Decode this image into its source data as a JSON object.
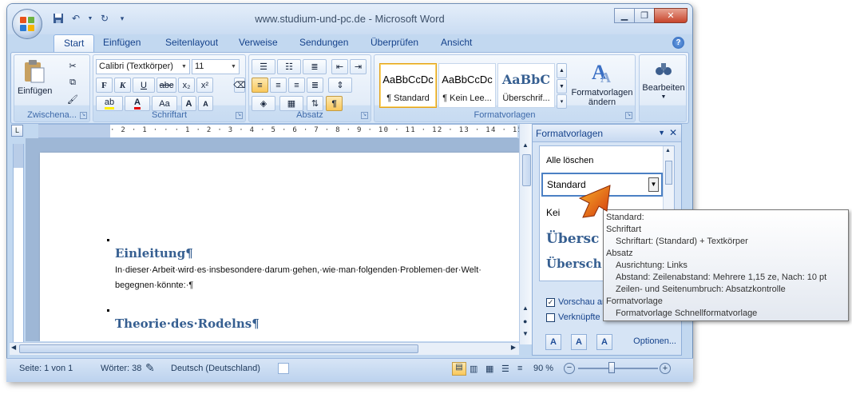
{
  "window": {
    "title": "www.studium-und-pc.de - Microsoft Word"
  },
  "quick_access": {
    "icons": [
      "save-icon",
      "undo-icon",
      "redo-icon",
      "customize-icon"
    ]
  },
  "tabs": [
    "Start",
    "Einfügen",
    "Seitenlayout",
    "Verweise",
    "Sendungen",
    "Überprüfen",
    "Ansicht"
  ],
  "ribbon": {
    "clipboard": {
      "paste_label": "Einfügen",
      "group_label": "Zwischena..."
    },
    "font": {
      "font_name": "Calibri (Textkörper)",
      "font_size": "11",
      "bold": "F",
      "italic": "K",
      "underline": "U",
      "strike": "abc",
      "sub": "x₂",
      "sup": "x²",
      "grow": "A",
      "shrink": "A",
      "case": "Aa",
      "group_label": "Schriftart"
    },
    "paragraph": {
      "group_label": "Absatz",
      "show_marks": "¶"
    },
    "styles": {
      "items": [
        {
          "sample": "AaBbCcDc",
          "name": "¶ Standard"
        },
        {
          "sample": "AaBbCcDc",
          "name": "¶ Kein Lee..."
        },
        {
          "sample": "AaBbC",
          "name": "Überschrif..."
        }
      ],
      "change_label_1": "Formatvorlagen",
      "change_label_2": "ändern",
      "group_label": "Formatvorlagen"
    },
    "editing": {
      "label": "Bearbeiten"
    }
  },
  "ruler": {
    "numbers": "· 2 · 1 · · · 1 · 2 · 3 · 4 · 5 · 6 · 7 · 8 · 9 · 10 · 11 · 12 · 13 · 14 · 15"
  },
  "document": {
    "heading1": "Einleitung¶",
    "para1_line1": "In·dieser·Arbeit·wird·es·insbesondere·darum·gehen,·wie·man·folgenden·Problemen·der·Welt·",
    "para1_line2": "begegnen·könnte:·¶",
    "heading2": "Theorie·des·Rodelns¶"
  },
  "task_pane": {
    "title": "Formatvorlagen",
    "clear_all": "Alle löschen",
    "selected_style": "Standard",
    "items": [
      "Kei",
      "Übersc",
      "Übersch"
    ],
    "preview_label": "Vorschau an",
    "linked_label": "Verknüpfte",
    "options_label": "Optionen..."
  },
  "tooltip": {
    "lines": [
      {
        "text": "Standard:",
        "indent": false
      },
      {
        "text": "Schriftart",
        "indent": false
      },
      {
        "text": "Schriftart:  (Standard) + Textkörper",
        "indent": true
      },
      {
        "text": "Absatz",
        "indent": false
      },
      {
        "text": "Ausrichtung:  Links",
        "indent": true
      },
      {
        "text": "Abstand:  Zeilenabstand:  Mehrere 1,15 ze, Nach:  10 pt",
        "indent": true
      },
      {
        "text": "Zeilen- und Seitenumbruch:  Absatzkontrolle",
        "indent": true
      },
      {
        "text": "Formatvorlage",
        "indent": false
      },
      {
        "text": "Formatvorlage Schnellformatvorlage",
        "indent": true
      }
    ]
  },
  "status": {
    "page": "Seite: 1 von 1",
    "words": "Wörter: 38",
    "language": "Deutsch (Deutschland)",
    "zoom": "90 %"
  },
  "colors": {
    "accent": "#15428b",
    "heading": "#365f91",
    "tooltip_arrow": "#d43a0e"
  }
}
